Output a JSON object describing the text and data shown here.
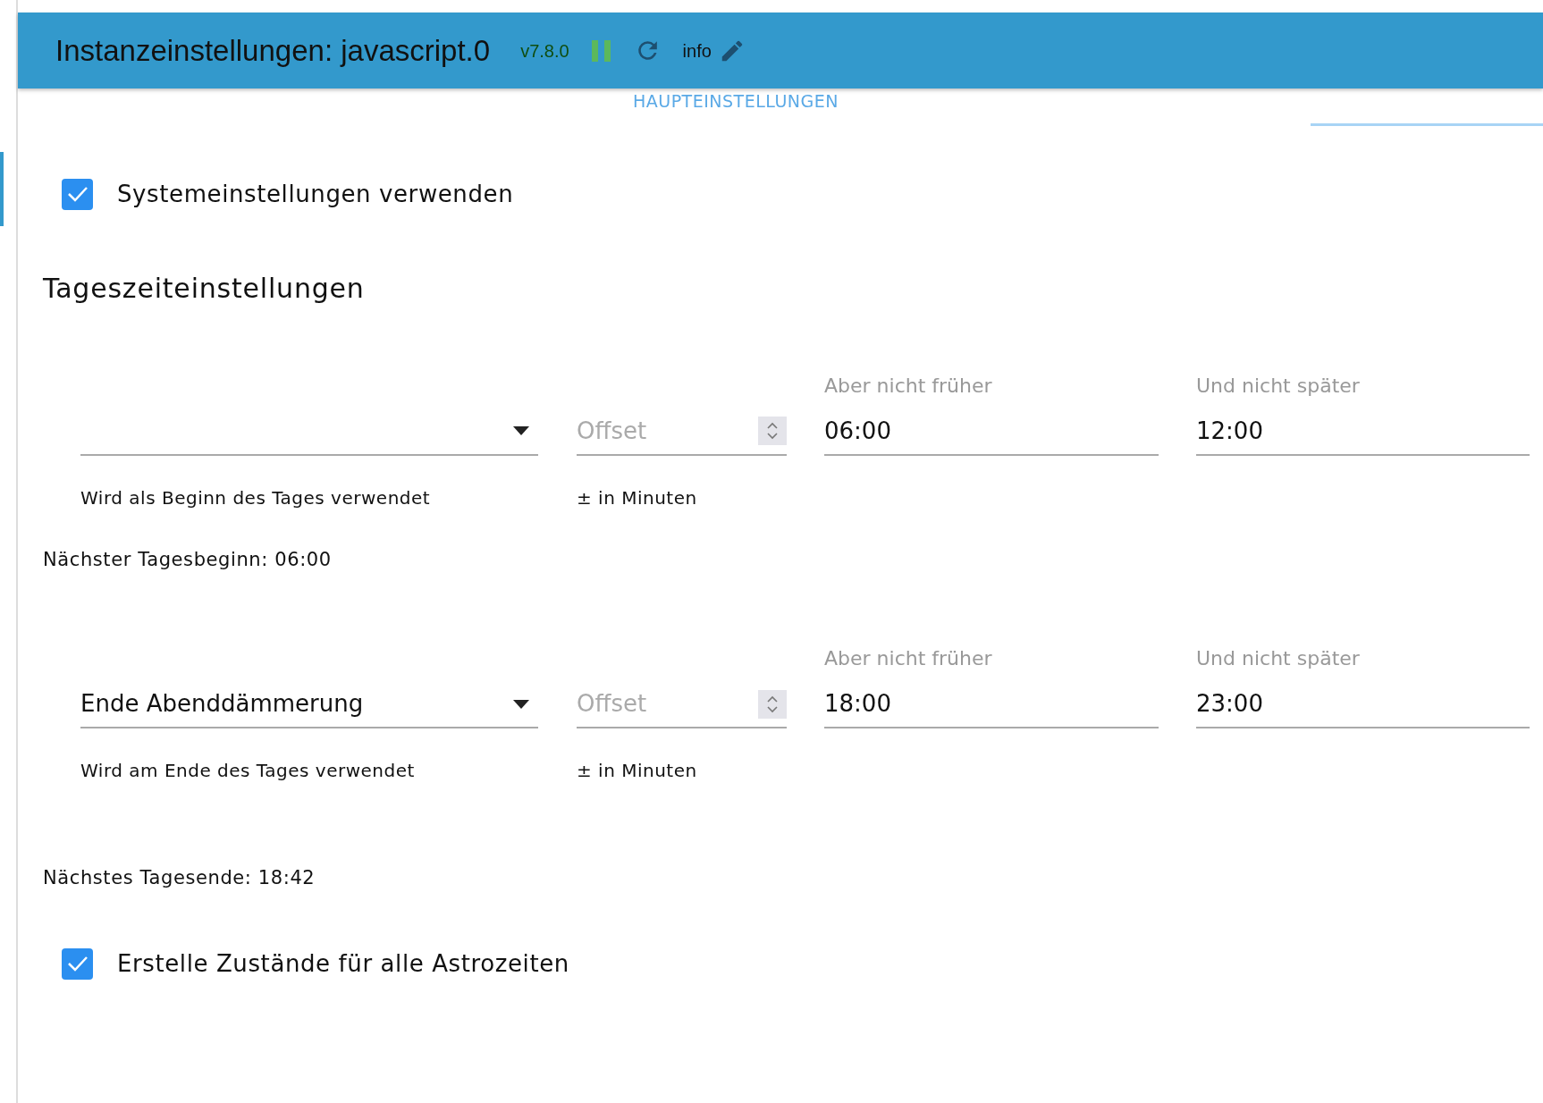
{
  "window": {
    "title": "Instanzeinstellungen: javascript.0",
    "version": "v7.8.0",
    "info": "info",
    "paused": true
  },
  "section_tab": "HAUPTEINSTELLUNGEN",
  "use_system_settings": {
    "label": "Systemeinstellungen verwenden",
    "checked": true
  },
  "section_title": "Tageszeiteinstellungen",
  "time_rows": [
    {
      "select_helper": "Wird als Beginn des Tages verwendet",
      "offset_placeholder": "Offset",
      "offset_helper": "± in Minuten",
      "not_before": {
        "label": "Aber nicht früher",
        "value": "06:00"
      },
      "not_after": {
        "label": "Und nicht später",
        "value": "12:00"
      },
      "next": "Nächster Tagesbeginn: 06:00"
    },
    {
      "select_value": "Ende Abenddämmerung",
      "select_helper": "Wird am Ende des Tages verwendet",
      "offset_placeholder": "Offset",
      "offset_helper": "± in Minuten",
      "not_before": {
        "label": "Aber nicht früher",
        "value": "18:00"
      },
      "not_after": {
        "label": "Und nicht später",
        "value": "23:00"
      },
      "next": "Nächstes Tagesende: 18:42"
    }
  ],
  "astro_states": {
    "label": "Erstelle Zustände für alle Astrozeiten",
    "checked": true
  }
}
